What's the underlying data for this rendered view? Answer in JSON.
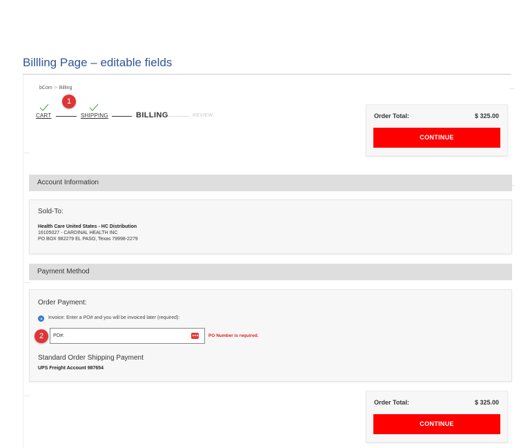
{
  "slide": {
    "title": "Billling Page – editable fields"
  },
  "breadcrumb": {
    "home": "bCom",
    "separator": ">",
    "current": "Billing"
  },
  "checkout_steps": [
    {
      "label": "CART",
      "state": "completed"
    },
    {
      "label": "SHIPPING",
      "state": "completed"
    },
    {
      "label": "BILLING",
      "state": "current"
    },
    {
      "label": "REVIEW",
      "state": "upcoming"
    }
  ],
  "markers": {
    "one": "1",
    "two": "2"
  },
  "order_summary_top": {
    "label": "Order Total:",
    "value": "$ 325.00",
    "button": "CONTINUE"
  },
  "order_summary_bottom": {
    "label": "Order Total:",
    "value": "$ 325.00",
    "button": "CONTINUE"
  },
  "account_section": {
    "header": "Account Information",
    "sold_to_title": "Sold-To:",
    "name": "Health Care United States - HC Distribution",
    "account_line": "16105027 - CARDINAL HEALTH INC",
    "address_line": "PO BOX 982279 EL PASO, Texas 79998-2279"
  },
  "payment_section": {
    "header": "Payment Method",
    "order_payment_title": "Order Payment:",
    "invoice_option": "Invoice: Enter a PO# and you will be invoiced later (required):",
    "po_label": "PO#:",
    "po_value": "",
    "po_error": "PO Number is required.",
    "shipping_payment_title": "Standard Order Shipping Payment",
    "shipping_payment_value": "UPS Freight Account 987654"
  },
  "colors": {
    "accent": "#ff0000",
    "title": "#2f5496",
    "marker": "#e03535",
    "radio": "#3a86d4",
    "check": "#4caf50"
  },
  "icons": {
    "check": "check-icon",
    "key": "password-key-icon",
    "radio": "radio-selected-icon"
  }
}
